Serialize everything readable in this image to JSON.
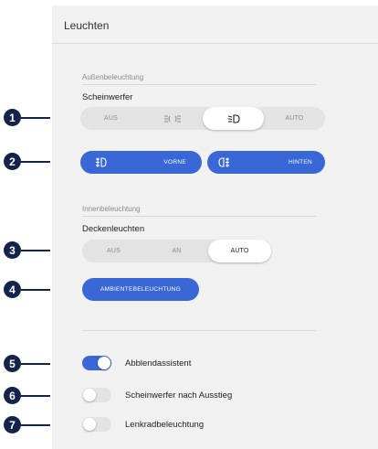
{
  "header": {
    "title": "Leuchten"
  },
  "exterior": {
    "section_label": "Außenbeleuchtung",
    "headlights": {
      "label": "Scheinwerfer",
      "options": [
        {
          "label": "AUS",
          "icon": "",
          "active": false
        },
        {
          "label": "",
          "icon": "parking-light-icon",
          "active": false
        },
        {
          "label": "",
          "icon": "low-beam-icon",
          "active": true
        },
        {
          "label": "AUTO",
          "icon": "",
          "active": false
        }
      ]
    },
    "fog_front": {
      "label": "VORNE",
      "icon": "front-fog-light-icon"
    },
    "fog_rear": {
      "label": "HINTEN",
      "icon": "rear-fog-light-icon"
    }
  },
  "interior": {
    "section_label": "Innenbeleuchtung",
    "ceiling": {
      "label": "Deckenleuchten",
      "options": [
        {
          "label": "AUS",
          "active": false
        },
        {
          "label": "AN",
          "active": false
        },
        {
          "label": "AUTO",
          "active": true
        }
      ]
    },
    "ambient_button": "AMBIENTEBELEUCHTUNG"
  },
  "toggles": [
    {
      "label": "Abblendassistent",
      "on": true
    },
    {
      "label": "Scheinwerfer nach Ausstieg",
      "on": false
    },
    {
      "label": "Lenkradbeleuchtung",
      "on": false
    }
  ],
  "callouts": [
    "1",
    "2",
    "3",
    "4",
    "5",
    "6",
    "7"
  ],
  "colors": {
    "accent": "#3a67d6",
    "callout": "#13234a",
    "panel": "#f1f1f1"
  }
}
